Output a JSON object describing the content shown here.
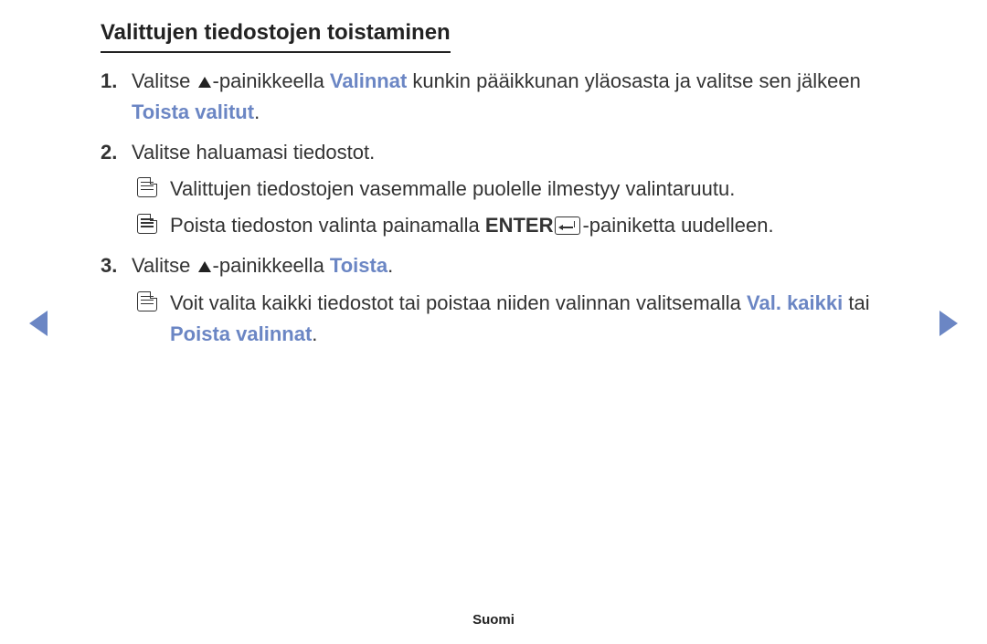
{
  "heading": "Valittujen tiedostojen toistaminen",
  "steps": {
    "s1": {
      "num": "1.",
      "t1": "Valitse ",
      "t2": "-painikkeella ",
      "hl1": "Valinnat",
      "t3": " kunkin pääikkunan yläosasta ja valitse sen jälkeen ",
      "hl2": "Toista valitut",
      "t4": "."
    },
    "s2": {
      "num": "2.",
      "t1": "Valitse haluamasi tiedostot.",
      "n1": "Valittujen tiedostojen vasemmalle puolelle ilmestyy valintaruutu.",
      "n2a": "Poista tiedoston valinta painamalla ",
      "n2b": "ENTER",
      "n2c": "-painiketta uudelleen."
    },
    "s3": {
      "num": "3.",
      "t1": "Valitse ",
      "t2": "-painikkeella ",
      "hl1": "Toista",
      "t3": ".",
      "n1a": "Voit valita kaikki tiedostot tai poistaa niiden valinnan valitsemalla ",
      "n1b": "Val. kaikki",
      "n1c": " tai ",
      "n1d": "Poista valinnat",
      "n1e": "."
    }
  },
  "footer": "Suomi"
}
